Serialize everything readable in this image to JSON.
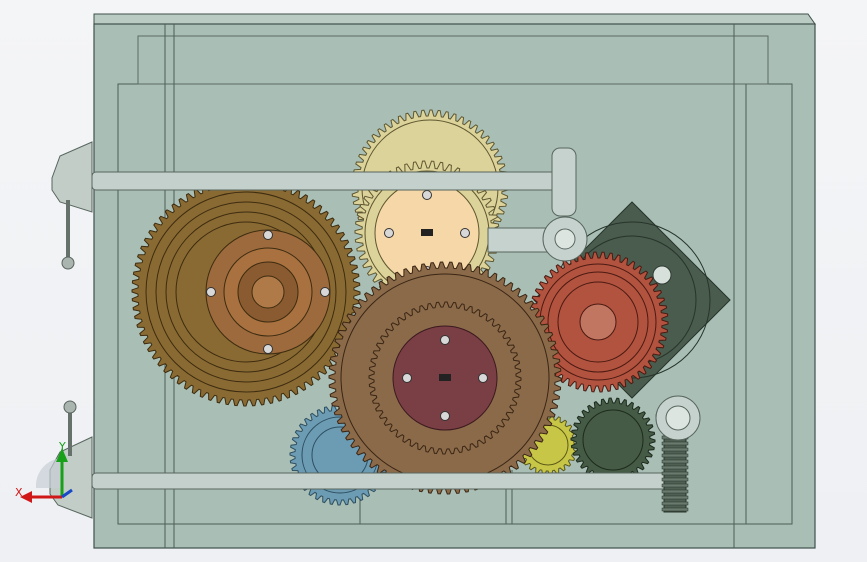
{
  "colors": {
    "viewport_background": "#f3f4f6",
    "housing_fill": "#a9bfb6",
    "housing_edge": "#3f504a",
    "gear_gold": "#8a6a33",
    "gear_cream": "#dcd39a",
    "gear_peach": "#f5d7a8",
    "gear_brown": "#8b6a4a",
    "hub_maroon": "#7a3e45",
    "gear_red": "#b2533f",
    "wheel_dark_green": "#4a5c4d",
    "gear_blue": "#6c9bb4",
    "gear_yellow": "#c7c646",
    "gear_green": "#455b45",
    "axis_x": "#d01818",
    "axis_y": "#18a018",
    "axis_z": "#1848c8"
  },
  "triad": {
    "x_label": "X",
    "y_label": "Y"
  },
  "components": {
    "housing": "transparent-gearbox-housing",
    "shafts": "horizontal-guide-shafts",
    "gears": "gear-train-assembly",
    "rack": "vertical-rack"
  }
}
